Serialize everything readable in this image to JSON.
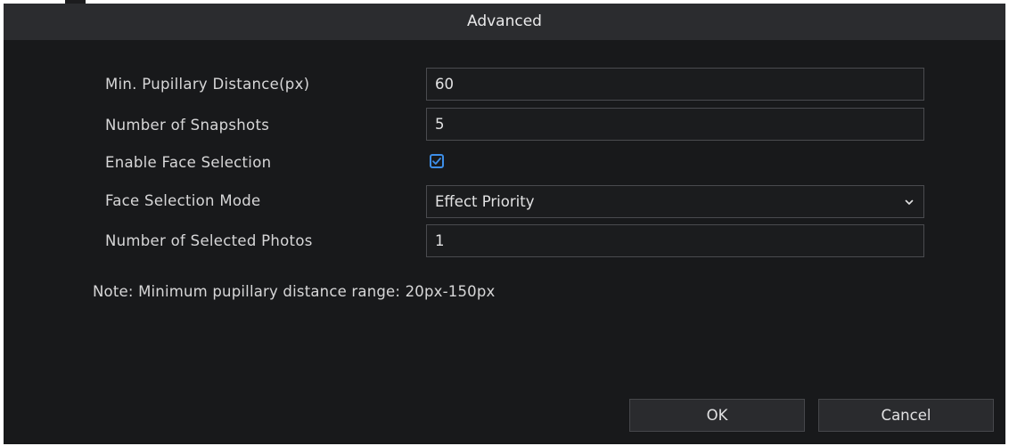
{
  "dialog": {
    "title": "Advanced"
  },
  "form": {
    "min_pupillary_distance": {
      "label": "Min. Pupillary Distance(px)",
      "value": "60"
    },
    "number_of_snapshots": {
      "label": "Number of Snapshots",
      "value": "5"
    },
    "enable_face_selection": {
      "label": "Enable Face Selection",
      "checked": true
    },
    "face_selection_mode": {
      "label": "Face Selection Mode",
      "value": "Effect Priority"
    },
    "number_of_selected_photos": {
      "label": "Number of Selected Photos",
      "value": "1"
    }
  },
  "note": "Note: Minimum pupillary distance range: 20px-150px",
  "buttons": {
    "ok": "OK",
    "cancel": "Cancel"
  },
  "icons": {
    "checkbox": "checkmark-icon",
    "dropdown": "chevron-down-icon"
  },
  "colors": {
    "background": "#18191b",
    "titlebar": "#2b2c2f",
    "accent": "#3d8ee8",
    "text": "#d7d7d8"
  }
}
